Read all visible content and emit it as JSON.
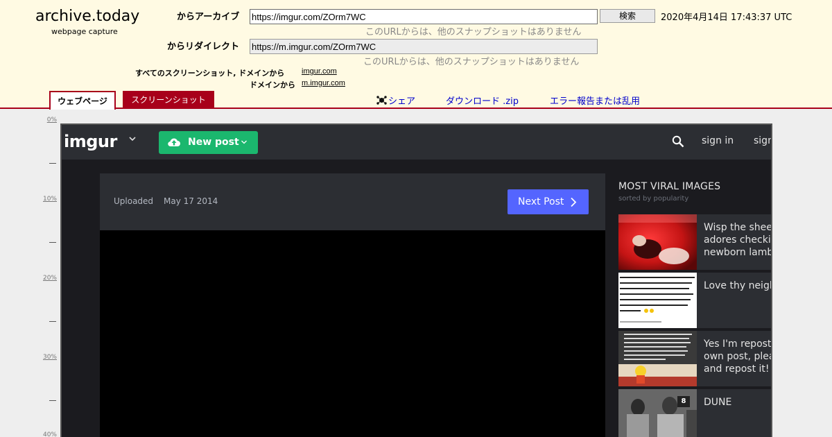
{
  "archive": {
    "logo_title": "archive.today",
    "logo_sub": "webpage capture",
    "archive_label": "からアーカイブ",
    "archive_url": "https://imgur.com/ZOrm7WC",
    "search_label": "検索",
    "timestamp": "2020年4月14日 17:43:37 UTC",
    "no_snapshots_1": "このURLからは、他のスナップショットはありません",
    "redirect_label": "からリダイレクト",
    "redirect_url": "https://m.imgur.com/ZOrm7WC",
    "no_snapshots_2": "このURLからは、他のスナップショットはありません",
    "all_screenshots_label": "すべてのスクリーンショット, ドメインから",
    "domain_1": "imgur.com",
    "domain_label_2": "ドメインから",
    "domain_2": "m.imgur.com",
    "tab_webpage": "ウェブページ",
    "tab_screenshot": "スクリーンショット",
    "share_label": "シェア",
    "download_label": "ダウンロード .zip",
    "report_label": "エラー報告または乱用",
    "accent_color": "#a8001a",
    "link_color": "#0000cc"
  },
  "ruler": {
    "labels": [
      "0%",
      "10%",
      "20%",
      "30%",
      "40%"
    ]
  },
  "imgur": {
    "logo": "imgur",
    "new_post": "New post",
    "sign_in": "sign in",
    "sign_up": "sign up",
    "uploaded_label": "Uploaded",
    "uploaded_date": "May 17 2014",
    "next_post": "Next Post",
    "most_viral_title": "MOST VIRAL IMAGES",
    "most_viral_sub": "sorted by popularity",
    "brand_green": "#1bb76e",
    "next_blue": "#5465ff",
    "viral_items": [
      {
        "line1": "Wisp the sheep",
        "line2": "adores checking",
        "line3": "newborn lambs"
      },
      {
        "line1": "Love thy neighbor",
        "line2": "",
        "line3": ""
      },
      {
        "line1": "Yes I'm reposting",
        "line2": "own post, please",
        "line3": "and repost it!"
      },
      {
        "line1": "DUNE",
        "line2": "",
        "line3": "",
        "badge": "8"
      }
    ]
  }
}
